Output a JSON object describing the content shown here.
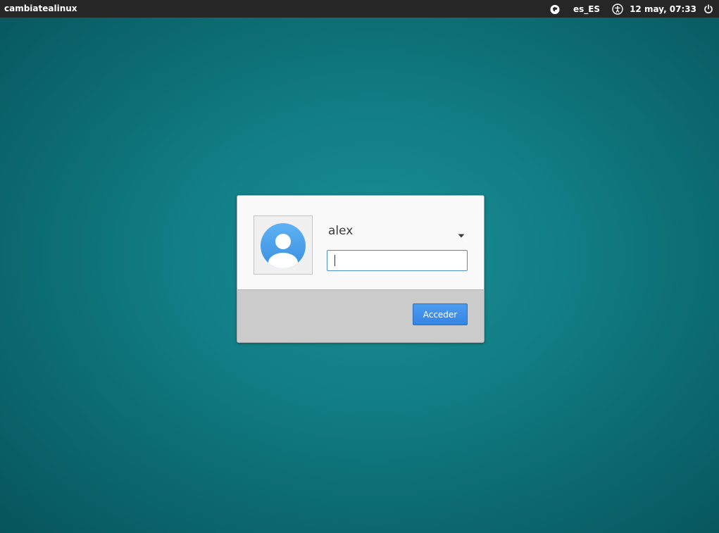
{
  "topbar": {
    "hostname": "cambiatealinux",
    "keyboard_icon": "keyboard-layout-icon",
    "language": "es_ES",
    "accessibility_icon": "accessibility-icon",
    "clock": "12 may, 07:33",
    "power_icon": "power-icon"
  },
  "login": {
    "avatar_icon": "user-avatar-icon",
    "username": "alex",
    "user_dropdown_icon": "chevron-down-icon",
    "password": {
      "value": "",
      "placeholder": ""
    },
    "login_label": "Acceder"
  },
  "colors": {
    "topbar_bg": "#262626",
    "desktop_bg": "#127f86",
    "button_accent": "#3b8ceb",
    "input_focus": "#4f8fcf"
  }
}
